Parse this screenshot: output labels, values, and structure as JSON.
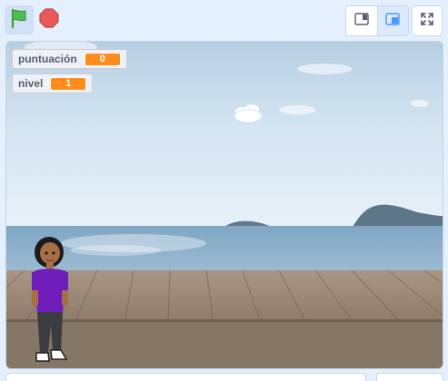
{
  "toolbar": {
    "green_flag_icon": "green-flag-icon",
    "stop_icon": "stop-sign-icon",
    "small_stage_icon": "small-stage-icon",
    "normal_stage_icon": "normal-stage-icon",
    "fullscreen_icon": "fullscreen-icon"
  },
  "monitors": {
    "score": {
      "label": "puntuación",
      "value": "0"
    },
    "level": {
      "label": "nivel",
      "value": "1"
    }
  },
  "colors": {
    "accent": "#4c97ff",
    "monitor_value": "#ff8c1a",
    "flag_green": "#4cbf56",
    "stop_red": "#ec5959"
  }
}
